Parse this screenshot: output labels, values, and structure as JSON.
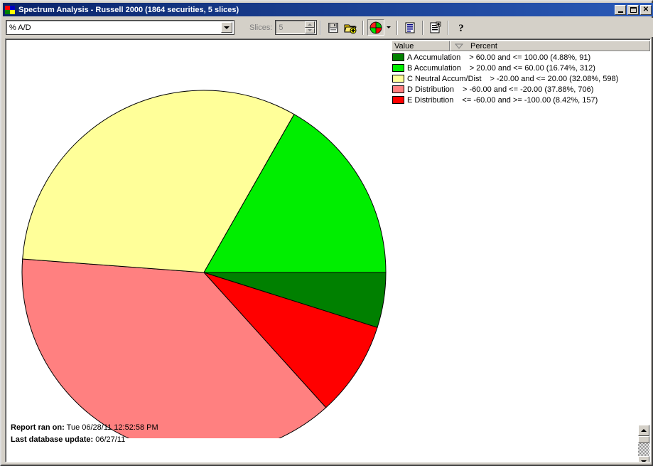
{
  "window": {
    "title": "Spectrum Analysis - Russell 2000 (1864 securities, 5 slices)",
    "minimize_label": "",
    "maximize_label": "",
    "close_label": "✕"
  },
  "toolbar": {
    "indicator_value": "% A/D",
    "slices_label": "Slices:",
    "slices_value": "5",
    "buttons": [
      {
        "name": "save-icon",
        "label": "Save"
      },
      {
        "name": "open-add-icon",
        "label": "Open"
      },
      {
        "name": "pie-chart-icon",
        "label": "Pie Chart"
      },
      {
        "name": "chart-type-dropdown-icon",
        "label": "Chart Type"
      },
      {
        "name": "report-list-icon",
        "label": "Report"
      },
      {
        "name": "report-add-icon",
        "label": "Add Report"
      },
      {
        "name": "help-icon",
        "label": "Help"
      }
    ]
  },
  "legend": {
    "columns": [
      "Value",
      "Percent"
    ],
    "sort_indicator": "descending",
    "rows": [
      {
        "color": "#008000",
        "name": "A Accumulation",
        "range": "> 60.00 and <= 100.00 (4.88%, 91)"
      },
      {
        "color": "#00ee00",
        "name": "B Accumulation",
        "range": "> 20.00 and <= 60.00 (16.74%, 312)"
      },
      {
        "color": "#ffff99",
        "name": "C Neutral Accum/Dist",
        "range": "> -20.00 and <= 20.00 (32.08%, 598)"
      },
      {
        "color": "#ff8080",
        "name": "D Distribution",
        "range": "> -60.00 and <= -20.00 (37.88%, 706)"
      },
      {
        "color": "#ff0000",
        "name": "E Distribution",
        "range": "<= -60.00 and >= -100.00 (8.42%, 157)"
      }
    ]
  },
  "footer": {
    "report_ran_label": "Report ran on:",
    "report_ran_value": "Tue 06/28/11 12:52:58 PM",
    "db_update_label": "Last database update:",
    "db_update_value": "06/27/11"
  },
  "chart_data": {
    "type": "pie",
    "title": "Spectrum Analysis - Russell 2000",
    "total_securities": 1864,
    "slice_count": 5,
    "start_angle": 0,
    "direction": "clockwise",
    "center": [
      278,
      327
    ],
    "radius": 256,
    "stroke": "#000000",
    "labels": [
      "A Accumulation",
      "E Distribution",
      "D Distribution",
      "C Neutral Accum/Dist",
      "B Accumulation"
    ],
    "values": [
      4.88,
      8.42,
      37.88,
      32.08,
      16.74
    ],
    "counts": [
      91,
      157,
      706,
      598,
      312
    ],
    "colors": [
      "#008000",
      "#ff0000",
      "#ff8080",
      "#ffff99",
      "#00ee00"
    ],
    "ylabel": "",
    "xlabel": "",
    "legend_position": "top-right",
    "grid": false
  }
}
